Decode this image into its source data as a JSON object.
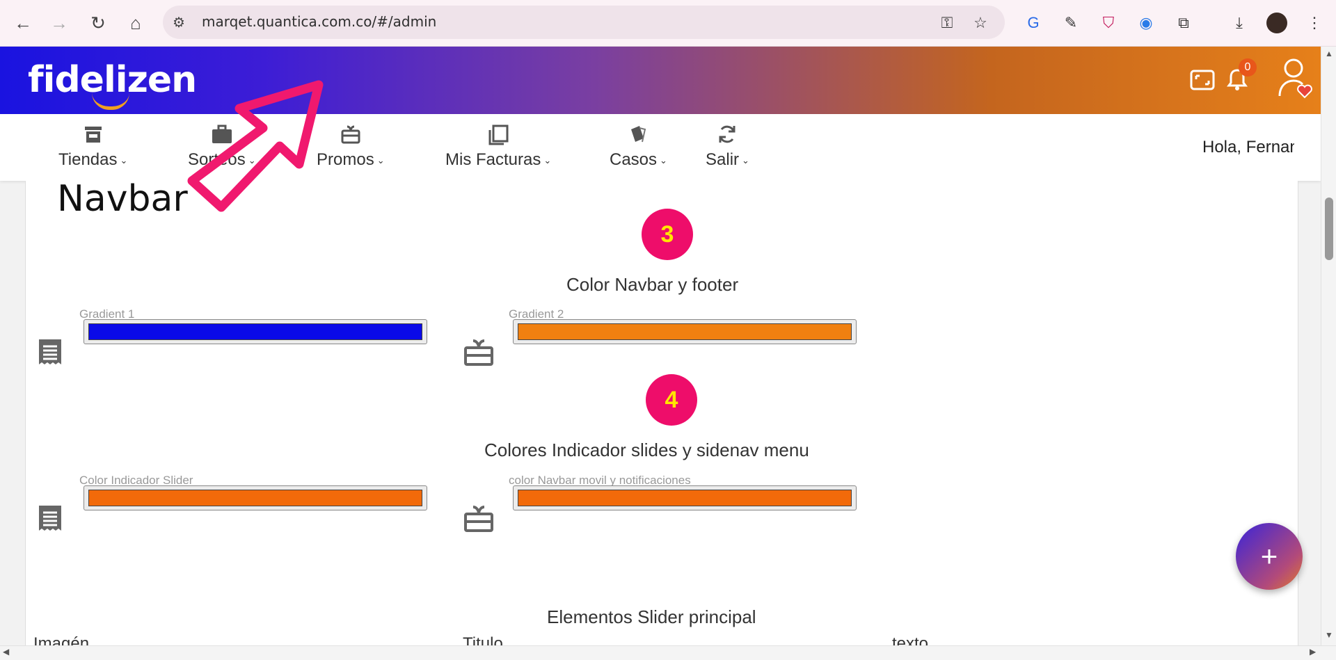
{
  "browser": {
    "url": "marqet.quantica.com.co/#/admin"
  },
  "header": {
    "logo_text": "fidelizen",
    "notification_count": "0"
  },
  "menu": [
    {
      "label": "Tiendas",
      "icon": "store-icon"
    },
    {
      "label": "Sorteos",
      "icon": "briefcase-icon"
    },
    {
      "label": "Promos",
      "icon": "gift-icon"
    },
    {
      "label": "Mis Facturas",
      "icon": "copy-icon"
    },
    {
      "label": "Casos",
      "icon": "cards-icon"
    },
    {
      "label": "Salir",
      "icon": "sync-icon"
    }
  ],
  "greeting": "Hola, Fernan",
  "page": {
    "section_title": "Navbar",
    "steps": [
      {
        "number": "3",
        "heading": "Color Navbar y footer",
        "fields": [
          {
            "label": "Gradient 1",
            "color": "#0a0ae8"
          },
          {
            "label": "Gradient 2",
            "color": "#f08010"
          }
        ]
      },
      {
        "number": "4",
        "heading": "Colores Indicador slides y sidenav menu",
        "fields": [
          {
            "label": "Color Indicador Slider",
            "color": "#f26a0a"
          },
          {
            "label": "color Navbar movil y notificaciones",
            "color": "#f26a0a"
          }
        ]
      }
    ],
    "slider_heading": "Elementos Slider principal",
    "columns": [
      "Imagén",
      "Titulo",
      "texto"
    ],
    "fab_label": "+"
  },
  "colors": {
    "accent_pink": "#ee0d6a",
    "step_number": "#ffe600"
  }
}
